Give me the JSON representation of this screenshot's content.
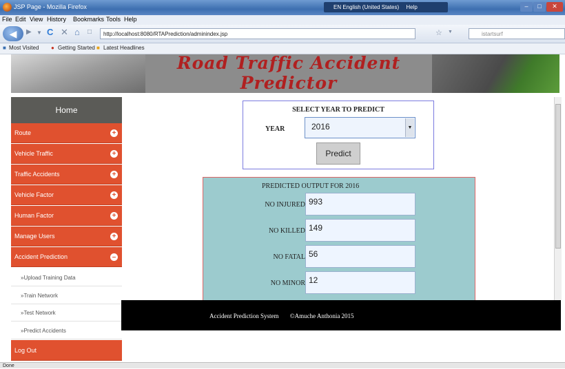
{
  "browser": {
    "window_title": "JSP Page - Mozilla Firefox",
    "language_indicator": "EN English (United States)",
    "help_label": "Help",
    "menu": [
      "File",
      "Edit",
      "View",
      "History",
      "Bookmarks",
      "Tools",
      "Help"
    ],
    "url": "http://localhost:8080/RTAPrediction/adminindex.jsp",
    "search_placeholder": "istartsurf",
    "bookmarks": [
      "Most Visited",
      "Getting Started",
      "Latest Headlines"
    ],
    "status": "Done"
  },
  "banner": {
    "title": "Road Traffic Accident Predictor"
  },
  "sidebar": {
    "home": "Home",
    "items": [
      {
        "label": "Route",
        "icon": "plus-icon"
      },
      {
        "label": "Vehicle Traffic",
        "icon": "plus-icon"
      },
      {
        "label": "Traffic Accidents",
        "icon": "plus-icon"
      },
      {
        "label": "Vehicle Factor",
        "icon": "plus-icon"
      },
      {
        "label": "Human Factor",
        "icon": "plus-icon"
      },
      {
        "label": "Manage Users",
        "icon": "plus-icon"
      },
      {
        "label": "Accident Prediction",
        "icon": "minus-icon"
      }
    ],
    "subitems": [
      "»Upload Training Data",
      "»Train Network",
      "»Test Network",
      "»Predict Accidents"
    ],
    "logout": "Log Out"
  },
  "select_panel": {
    "heading": "SELECT YEAR TO PREDICT",
    "year_label": "YEAR",
    "year_value": "2016",
    "predict_button": "Predict"
  },
  "output_panel": {
    "heading": "PREDICTED OUTPUT FOR 2016",
    "rows": [
      {
        "label": "NO INJURED",
        "value": "993"
      },
      {
        "label": "NO KILLED",
        "value": "149"
      },
      {
        "label": "NO FATAL",
        "value": "56"
      },
      {
        "label": "NO MINOR",
        "value": "12"
      }
    ]
  },
  "footer": {
    "system": "Accident Prediction System",
    "copyright": "©Amuche Anthonia 2015"
  },
  "colors": {
    "sidebar_accent": "#e0512f",
    "home_bg": "#5b5b57",
    "output_bg": "#9ccbce",
    "footer_bg": "#000000"
  }
}
